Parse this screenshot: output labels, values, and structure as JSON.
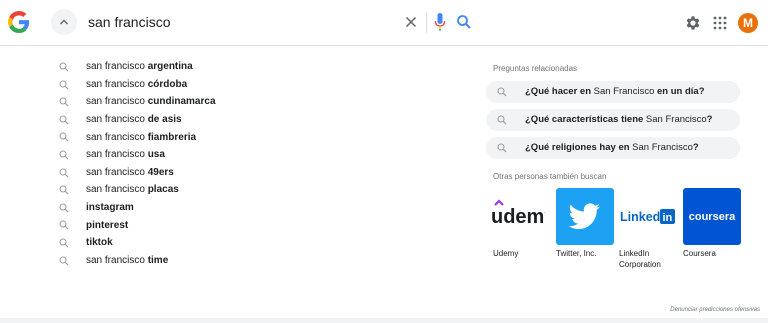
{
  "search": {
    "query": "san francisco"
  },
  "account": {
    "initial": "M",
    "color": "#e8710a"
  },
  "suggestions": [
    {
      "prefix": "san francisco ",
      "bold": "argentina"
    },
    {
      "prefix": "san francisco ",
      "bold": "córdoba"
    },
    {
      "prefix": "san francisco ",
      "bold": "cundinamarca"
    },
    {
      "prefix": "san francisco ",
      "bold": "de asis"
    },
    {
      "prefix": "san francisco ",
      "bold": "fiambreria"
    },
    {
      "prefix": "san francisco ",
      "bold": "usa"
    },
    {
      "prefix": "san francisco ",
      "bold": "49ers"
    },
    {
      "prefix": "san francisco ",
      "bold": "placas"
    },
    {
      "prefix": "",
      "bold": "instagram"
    },
    {
      "prefix": "",
      "bold": "pinterest"
    },
    {
      "prefix": "",
      "bold": "tiktok"
    },
    {
      "prefix": "san francisco ",
      "bold": "time"
    }
  ],
  "related": {
    "heading": "Preguntas relacionadas",
    "questions": [
      {
        "a": "¿Qué hacer en",
        "b": " San Francisco ",
        "c": "en un día?"
      },
      {
        "a": "¿Qué características tiene",
        "b": " San Francisco",
        "c": "?"
      },
      {
        "a": "¿Qué religiones hay en",
        "b": " San Francisco",
        "c": "?"
      }
    ]
  },
  "others": {
    "heading": "Otras personas también buscan",
    "items": [
      {
        "label": "Udemy",
        "logo": "udemy",
        "color": "#1c1d1f"
      },
      {
        "label": "Twitter, Inc.",
        "logo": "twitter",
        "color": "#1da1f2"
      },
      {
        "label": "LinkedIn Corporation",
        "logo": "Linked",
        "logo_suffix": "in",
        "color": "#0a66c2"
      },
      {
        "label": "Coursera",
        "logo": "coursera",
        "color": "#0056d2"
      }
    ]
  },
  "footer": {
    "link": "Denunciar predicciones ofensivas"
  },
  "colors": {
    "accent_blue": "#4285f4",
    "red": "#ea4335",
    "yellow": "#fbbc05",
    "green": "#34a853"
  }
}
